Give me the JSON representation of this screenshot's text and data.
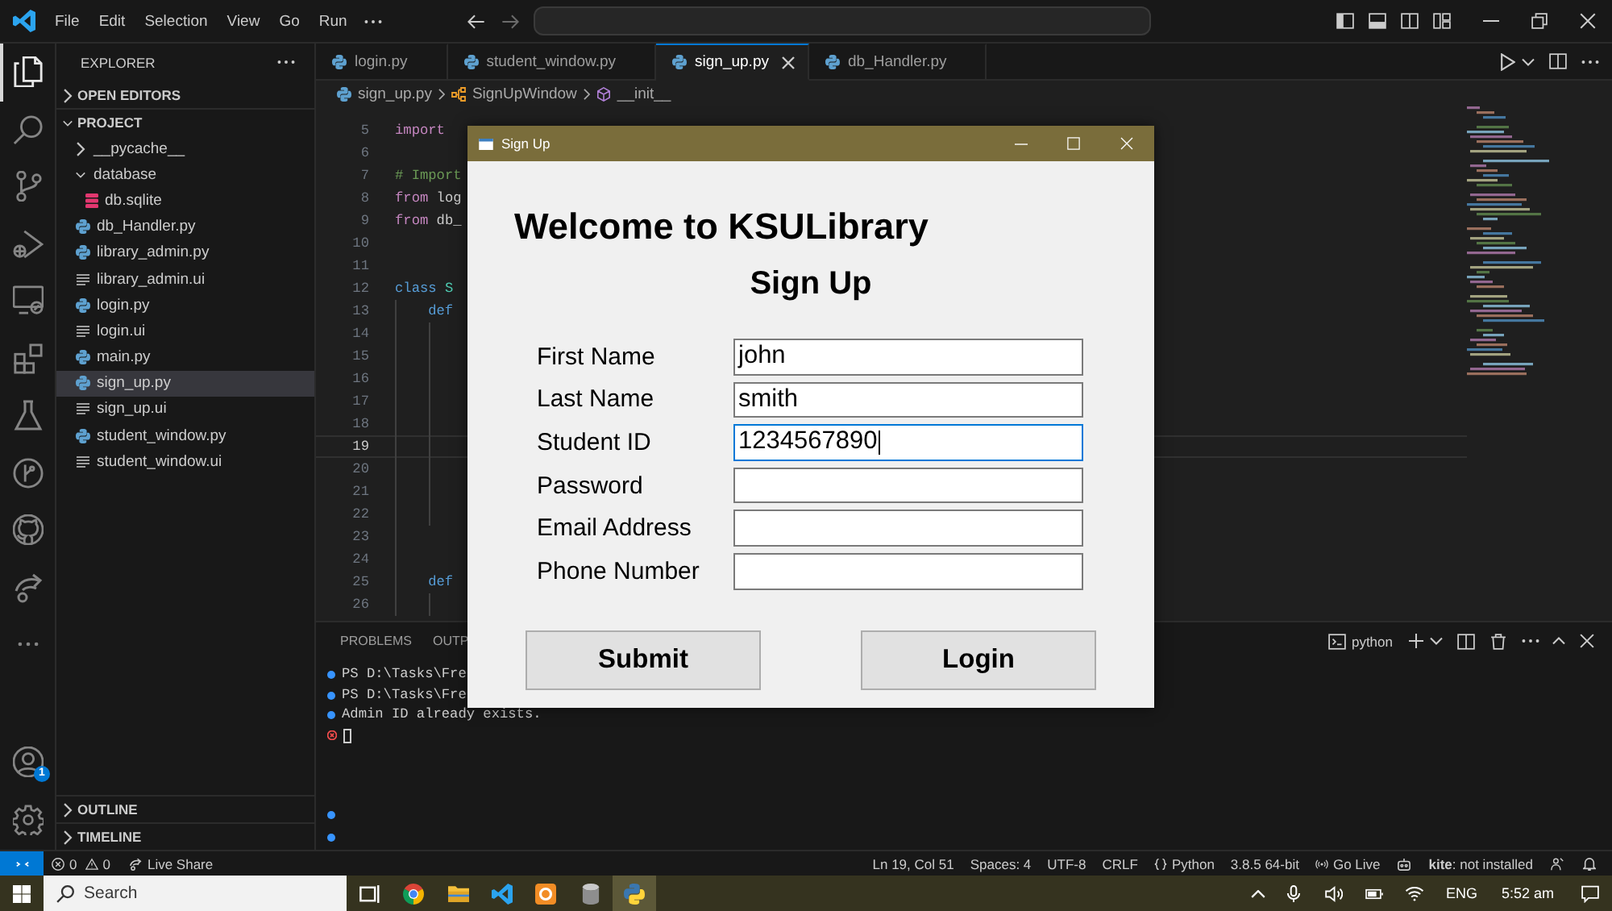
{
  "title_bar": {
    "menus": [
      "File",
      "Edit",
      "Selection",
      "View",
      "Go",
      "Run"
    ]
  },
  "activity_bar": {
    "items": [
      {
        "kind": "files",
        "selected": true
      },
      {
        "kind": "search",
        "selected": false
      },
      {
        "kind": "source-control",
        "selected": false
      },
      {
        "kind": "run-debug",
        "selected": false
      },
      {
        "kind": "remote",
        "selected": false
      },
      {
        "kind": "extensions",
        "selected": false
      },
      {
        "kind": "testing",
        "selected": false
      },
      {
        "kind": "timeline",
        "selected": false
      },
      {
        "kind": "github",
        "selected": false
      },
      {
        "kind": "live-share",
        "selected": false
      },
      {
        "kind": "more",
        "selected": false
      }
    ],
    "account_badge": "1"
  },
  "sidebar": {
    "title": "EXPLORER",
    "sections": [
      {
        "label": "OPEN EDITORS",
        "expanded": false
      },
      {
        "label": "PROJECT",
        "expanded": true,
        "children": [
          {
            "label": "__pycache__",
            "kind": "folder",
            "expanded": false,
            "selected": false
          },
          {
            "label": "database",
            "kind": "folder",
            "expanded": true,
            "selected": false,
            "children": [
              {
                "label": "db.sqlite",
                "kind": "database",
                "selected": false
              }
            ]
          },
          {
            "label": "db_Handler.py",
            "kind": "python",
            "selected": false
          },
          {
            "label": "library_admin.py",
            "kind": "python",
            "selected": false
          },
          {
            "label": "library_admin.ui",
            "kind": "text",
            "selected": false
          },
          {
            "label": "login.py",
            "kind": "python",
            "selected": false
          },
          {
            "label": "login.ui",
            "kind": "text",
            "selected": false
          },
          {
            "label": "main.py",
            "kind": "python",
            "selected": false
          },
          {
            "label": "sign_up.py",
            "kind": "python",
            "selected": true
          },
          {
            "label": "sign_up.ui",
            "kind": "text",
            "selected": false
          },
          {
            "label": "student_window.py",
            "kind": "python",
            "selected": false
          },
          {
            "label": "student_window.ui",
            "kind": "text",
            "selected": false
          }
        ]
      },
      {
        "label": "OUTLINE",
        "expanded": false
      },
      {
        "label": "TIMELINE",
        "expanded": false
      }
    ]
  },
  "editor": {
    "tabs": [
      {
        "label": "login.py",
        "selected": false
      },
      {
        "label": "student_window.py",
        "selected": false
      },
      {
        "label": "sign_up.py",
        "selected": true
      },
      {
        "label": "db_Handler.py",
        "selected": false
      }
    ],
    "breadcrumb": [
      {
        "label": "sign_up.py",
        "kind": "file"
      },
      {
        "label": "SignUpWindow",
        "kind": "class"
      },
      {
        "label": "__init__",
        "kind": "method"
      }
    ],
    "lines": [
      {
        "number": "5",
        "current": false,
        "tokens": [
          {
            "text": "import",
            "kind": "keyword"
          }
        ]
      },
      {
        "number": "6",
        "current": false
      },
      {
        "number": "7",
        "current": false,
        "tokens": [
          {
            "text": "# Import",
            "kind": "comment"
          }
        ]
      },
      {
        "number": "8",
        "current": false,
        "tokens": [
          {
            "text": "from",
            "kind": "keyword"
          },
          {
            "text": " log",
            "kind": "name"
          }
        ]
      },
      {
        "number": "9",
        "current": false,
        "tokens": [
          {
            "text": "from",
            "kind": "keyword"
          },
          {
            "text": " db_",
            "kind": "name"
          }
        ]
      },
      {
        "number": "10",
        "current": false
      },
      {
        "number": "11",
        "current": false
      },
      {
        "number": "12",
        "current": false,
        "tokens": [
          {
            "text": "class",
            "kind": "storage"
          },
          {
            "text": " S",
            "kind": "type"
          }
        ],
        "children": [
          {
            "number": "13",
            "current": false,
            "tokens": [
              {
                "text": "def",
                "kind": "storage"
              }
            ],
            "children": [
              {
                "number": "14",
                "current": false
              },
              {
                "number": "15",
                "current": false
              },
              {
                "number": "16",
                "current": false
              },
              {
                "number": "17",
                "current": false
              },
              {
                "number": "18",
                "current": false
              },
              {
                "number": "19",
                "current": true
              },
              {
                "number": "20",
                "current": false
              },
              {
                "number": "21",
                "current": false
              },
              {
                "number": "22",
                "current": false
              }
            ]
          },
          {
            "number": "23",
            "current": false
          },
          {
            "number": "24",
            "current": false
          },
          {
            "number": "25",
            "current": false,
            "tokens": [
              {
                "text": "def",
                "kind": "storage"
              }
            ],
            "children": [
              {
                "number": "26",
                "current": false
              }
            ]
          }
        ]
      }
    ]
  },
  "panel": {
    "tabs": [
      {
        "label": "PROBLEMS",
        "selected": false
      },
      {
        "label": "OUTP",
        "selected": false
      }
    ],
    "terminal_name": "python",
    "lines": [
      {
        "kind": "success",
        "text": "PS D:\\Tasks\\Fre",
        "cursor": false
      },
      {
        "kind": "success",
        "text": "PS D:\\Tasks\\Fre",
        "cursor": false
      },
      {
        "kind": "success",
        "text": "Admin ID already exists.",
        "cursor": false
      },
      {
        "kind": "error",
        "cursor": true
      }
    ],
    "gutter_marks": [
      {
        "kind": "success"
      },
      {
        "kind": "success"
      }
    ]
  },
  "dialog": {
    "title": "Sign Up",
    "heading": "Welcome to KSULibrary",
    "subheading": "Sign Up",
    "fields": [
      {
        "label": "First Name",
        "value": "john",
        "focused": false
      },
      {
        "label": "Last Name",
        "value": "smith",
        "focused": false
      },
      {
        "label": "Student ID",
        "value": "1234567890",
        "focused": true
      },
      {
        "label": "Password",
        "focused": false
      },
      {
        "label": "Email Address",
        "focused": false
      },
      {
        "label": "Phone Number",
        "focused": false
      }
    ],
    "buttons": [
      "Submit",
      "Login"
    ]
  },
  "status_bar": {
    "problems": [
      {
        "kind": "error",
        "count": "0"
      },
      {
        "kind": "warning",
        "count": "0"
      }
    ],
    "left": [
      {
        "kind": "live-share",
        "label": "Live Share"
      }
    ],
    "right": [
      {
        "kind": "text",
        "label": "Ln 19, Col 51"
      },
      {
        "kind": "text",
        "label": "Spaces: 4"
      },
      {
        "kind": "text",
        "label": "UTF-8"
      },
      {
        "kind": "text",
        "label": "CRLF"
      },
      {
        "kind": "language",
        "label": "Python"
      },
      {
        "kind": "text",
        "label": "3.8.5 64-bit"
      },
      {
        "kind": "go-live",
        "label": "Go Live"
      },
      {
        "kind": "bot"
      },
      {
        "kind": "text",
        "label": "**kite**: not installed"
      },
      {
        "kind": "feedback"
      },
      {
        "kind": "bell"
      }
    ]
  },
  "taskbar": {
    "search": {
      "placeholder": "Search"
    },
    "apps": [
      {
        "kind": "task-view",
        "selected": false
      },
      {
        "kind": "chrome",
        "selected": false
      },
      {
        "kind": "files",
        "selected": false
      },
      {
        "kind": "vscode",
        "selected": false
      },
      {
        "kind": "app",
        "selected": false
      },
      {
        "kind": "database",
        "selected": false
      },
      {
        "kind": "python",
        "selected": true
      }
    ],
    "tray": {
      "language": "ENG",
      "time": "5:52 am"
    }
  }
}
